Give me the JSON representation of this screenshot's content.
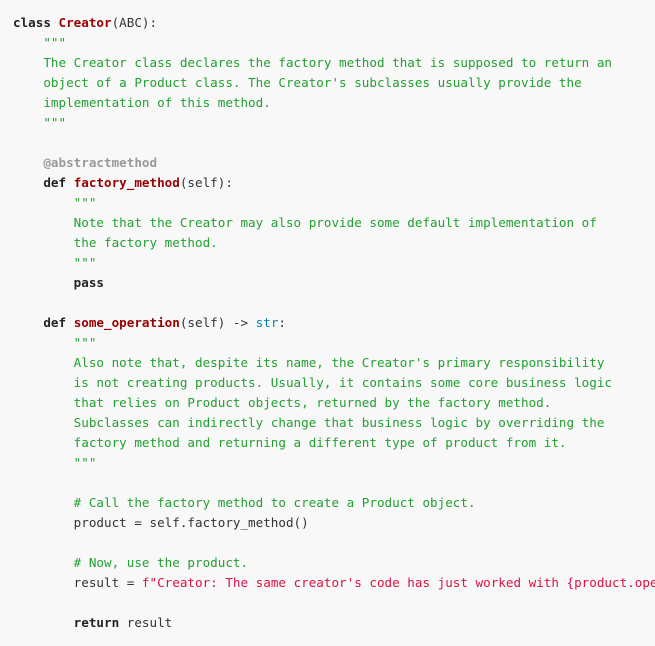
{
  "colors": {
    "background": "#f8f8f8",
    "keyword": "#222222",
    "name": "#990000",
    "string": "#22a030",
    "decorator": "#999999",
    "builtin": "#0086b3",
    "fstring": "#dd1144",
    "text": "#333333"
  },
  "lines": [
    {
      "indent": "",
      "tokens": [
        {
          "t": "kw",
          "v": "class"
        },
        {
          "t": "txt",
          "v": " "
        },
        {
          "t": "name",
          "v": "Creator"
        },
        {
          "t": "txt",
          "v": "(ABC):"
        }
      ]
    },
    {
      "indent": "    ",
      "tokens": [
        {
          "t": "str",
          "v": "\"\"\""
        }
      ]
    },
    {
      "indent": "    ",
      "tokens": [
        {
          "t": "str",
          "v": "The Creator class declares the factory method that is supposed to return an"
        }
      ]
    },
    {
      "indent": "    ",
      "tokens": [
        {
          "t": "str",
          "v": "object of a Product class. The Creator's subclasses usually provide the"
        }
      ]
    },
    {
      "indent": "    ",
      "tokens": [
        {
          "t": "str",
          "v": "implementation of this method."
        }
      ]
    },
    {
      "indent": "    ",
      "tokens": [
        {
          "t": "str",
          "v": "\"\"\""
        }
      ]
    },
    {
      "indent": "",
      "tokens": []
    },
    {
      "indent": "    ",
      "tokens": [
        {
          "t": "deco",
          "v": "@abstractmethod"
        }
      ]
    },
    {
      "indent": "    ",
      "tokens": [
        {
          "t": "kw",
          "v": "def"
        },
        {
          "t": "txt",
          "v": " "
        },
        {
          "t": "name",
          "v": "factory_method"
        },
        {
          "t": "txt",
          "v": "(self):"
        }
      ]
    },
    {
      "indent": "        ",
      "tokens": [
        {
          "t": "str",
          "v": "\"\"\""
        }
      ]
    },
    {
      "indent": "        ",
      "tokens": [
        {
          "t": "str",
          "v": "Note that the Creator may also provide some default implementation of"
        }
      ]
    },
    {
      "indent": "        ",
      "tokens": [
        {
          "t": "str",
          "v": "the factory method."
        }
      ]
    },
    {
      "indent": "        ",
      "tokens": [
        {
          "t": "str",
          "v": "\"\"\""
        }
      ]
    },
    {
      "indent": "        ",
      "tokens": [
        {
          "t": "kw",
          "v": "pass"
        }
      ]
    },
    {
      "indent": "",
      "tokens": []
    },
    {
      "indent": "    ",
      "tokens": [
        {
          "t": "kw",
          "v": "def"
        },
        {
          "t": "txt",
          "v": " "
        },
        {
          "t": "name",
          "v": "some_operation"
        },
        {
          "t": "txt",
          "v": "(self) -> "
        },
        {
          "t": "bi",
          "v": "str"
        },
        {
          "t": "txt",
          "v": ":"
        }
      ]
    },
    {
      "indent": "        ",
      "tokens": [
        {
          "t": "str",
          "v": "\"\"\""
        }
      ]
    },
    {
      "indent": "        ",
      "tokens": [
        {
          "t": "str",
          "v": "Also note that, despite its name, the Creator's primary responsibility"
        }
      ]
    },
    {
      "indent": "        ",
      "tokens": [
        {
          "t": "str",
          "v": "is not creating products. Usually, it contains some core business logic"
        }
      ]
    },
    {
      "indent": "        ",
      "tokens": [
        {
          "t": "str",
          "v": "that relies on Product objects, returned by the factory method."
        }
      ]
    },
    {
      "indent": "        ",
      "tokens": [
        {
          "t": "str",
          "v": "Subclasses can indirectly change that business logic by overriding the"
        }
      ]
    },
    {
      "indent": "        ",
      "tokens": [
        {
          "t": "str",
          "v": "factory method and returning a different type of product from it."
        }
      ]
    },
    {
      "indent": "        ",
      "tokens": [
        {
          "t": "str",
          "v": "\"\"\""
        }
      ]
    },
    {
      "indent": "",
      "tokens": []
    },
    {
      "indent": "        ",
      "tokens": [
        {
          "t": "com",
          "v": "# Call the factory method to create a Product object."
        }
      ]
    },
    {
      "indent": "        ",
      "tokens": [
        {
          "t": "txt",
          "v": "product = self.factory_method()"
        }
      ]
    },
    {
      "indent": "",
      "tokens": []
    },
    {
      "indent": "        ",
      "tokens": [
        {
          "t": "com",
          "v": "# Now, use the product."
        }
      ]
    },
    {
      "indent": "        ",
      "tokens": [
        {
          "t": "txt",
          "v": "result = "
        },
        {
          "t": "fstr",
          "v": "f\"Creator: The same creator's code has just worked with {product.operation()}\""
        }
      ]
    },
    {
      "indent": "",
      "tokens": []
    },
    {
      "indent": "        ",
      "tokens": [
        {
          "t": "kw",
          "v": "return"
        },
        {
          "t": "txt",
          "v": " result"
        }
      ]
    }
  ]
}
